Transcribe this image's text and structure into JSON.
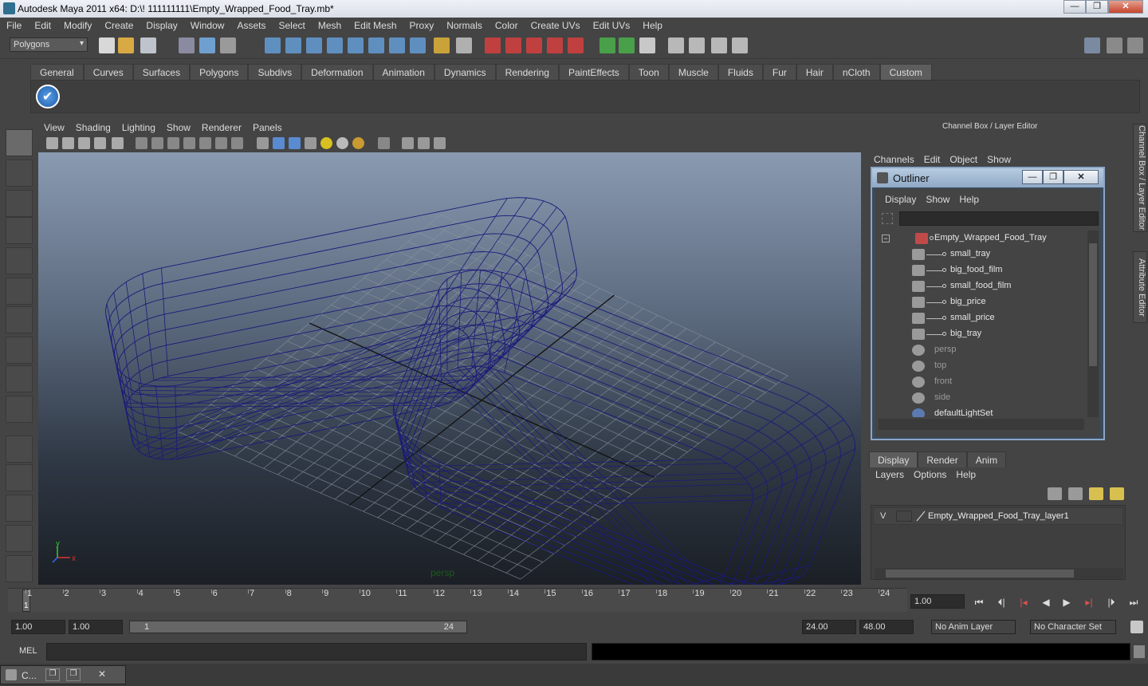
{
  "window": {
    "title": "Autodesk Maya 2011 x64: D:\\! 111111111\\Empty_Wrapped_Food_Tray.mb*",
    "btn_min": "—",
    "btn_max": "❐",
    "btn_close": "✕"
  },
  "menubar": [
    "File",
    "Edit",
    "Modify",
    "Create",
    "Display",
    "Window",
    "Assets",
    "Select",
    "Mesh",
    "Edit Mesh",
    "Proxy",
    "Normals",
    "Color",
    "Create UVs",
    "Edit UVs",
    "Help"
  ],
  "status": {
    "mode": "Polygons"
  },
  "shelf": {
    "tabs": [
      "General",
      "Curves",
      "Surfaces",
      "Polygons",
      "Subdivs",
      "Deformation",
      "Animation",
      "Dynamics",
      "Rendering",
      "PaintEffects",
      "Toon",
      "Muscle",
      "Fluids",
      "Fur",
      "Hair",
      "nCloth",
      "Custom"
    ],
    "active_tab": "Custom"
  },
  "panel": {
    "menu": [
      "View",
      "Shading",
      "Lighting",
      "Show",
      "Renderer",
      "Panels"
    ],
    "camera_label": "persp",
    "axis_x": "x",
    "axis_y": "y",
    "wire_color": "#1a1a7a"
  },
  "channel_box": {
    "title": "Channel Box / Layer Editor",
    "menu": [
      "Channels",
      "Edit",
      "Object",
      "Show"
    ]
  },
  "side_tabs": [
    "Channel Box / Layer Editor",
    "Attribute Editor"
  ],
  "outliner": {
    "title": "Outliner",
    "menu": [
      "Display",
      "Show",
      "Help"
    ],
    "items": [
      {
        "label": "Empty_Wrapped_Food_Tray",
        "type": "group",
        "level": 0,
        "dim": false
      },
      {
        "label": "small_tray",
        "type": "mesh",
        "level": 1,
        "dim": false
      },
      {
        "label": "big_food_film",
        "type": "mesh",
        "level": 1,
        "dim": false
      },
      {
        "label": "small_food_film",
        "type": "mesh",
        "level": 1,
        "dim": false
      },
      {
        "label": "big_price",
        "type": "mesh",
        "level": 1,
        "dim": false
      },
      {
        "label": "small_price",
        "type": "mesh",
        "level": 1,
        "dim": false
      },
      {
        "label": "big_tray",
        "type": "mesh",
        "level": 1,
        "dim": false
      },
      {
        "label": "persp",
        "type": "camera",
        "level": 0,
        "dim": true
      },
      {
        "label": "top",
        "type": "camera",
        "level": 0,
        "dim": true
      },
      {
        "label": "front",
        "type": "camera",
        "level": 0,
        "dim": true
      },
      {
        "label": "side",
        "type": "camera",
        "level": 0,
        "dim": true
      },
      {
        "label": "defaultLightSet",
        "type": "set",
        "level": 0,
        "dim": false
      }
    ]
  },
  "layer_editor": {
    "tabs": [
      "Display",
      "Render",
      "Anim"
    ],
    "active_tab": "Display",
    "menu": [
      "Layers",
      "Options",
      "Help"
    ],
    "layers": [
      {
        "visible": "V",
        "name": "Empty_Wrapped_Food_Tray_layer1"
      }
    ]
  },
  "timeline": {
    "ticks": [
      "1",
      "2",
      "3",
      "4",
      "5",
      "6",
      "7",
      "8",
      "9",
      "10",
      "11",
      "12",
      "13",
      "14",
      "15",
      "16",
      "17",
      "18",
      "19",
      "20",
      "21",
      "22",
      "23",
      "24"
    ],
    "current_frame": "1",
    "current_time": "1.00"
  },
  "range": {
    "start_time": "1.00",
    "playback_start": "1.00",
    "slider_start": "1",
    "slider_end": "24",
    "playback_end": "24.00",
    "end_time": "48.00",
    "anim_layer": "No Anim Layer",
    "character_set": "No Character Set"
  },
  "cmdline": {
    "label": "MEL"
  },
  "taskbar": {
    "label": "C..."
  }
}
